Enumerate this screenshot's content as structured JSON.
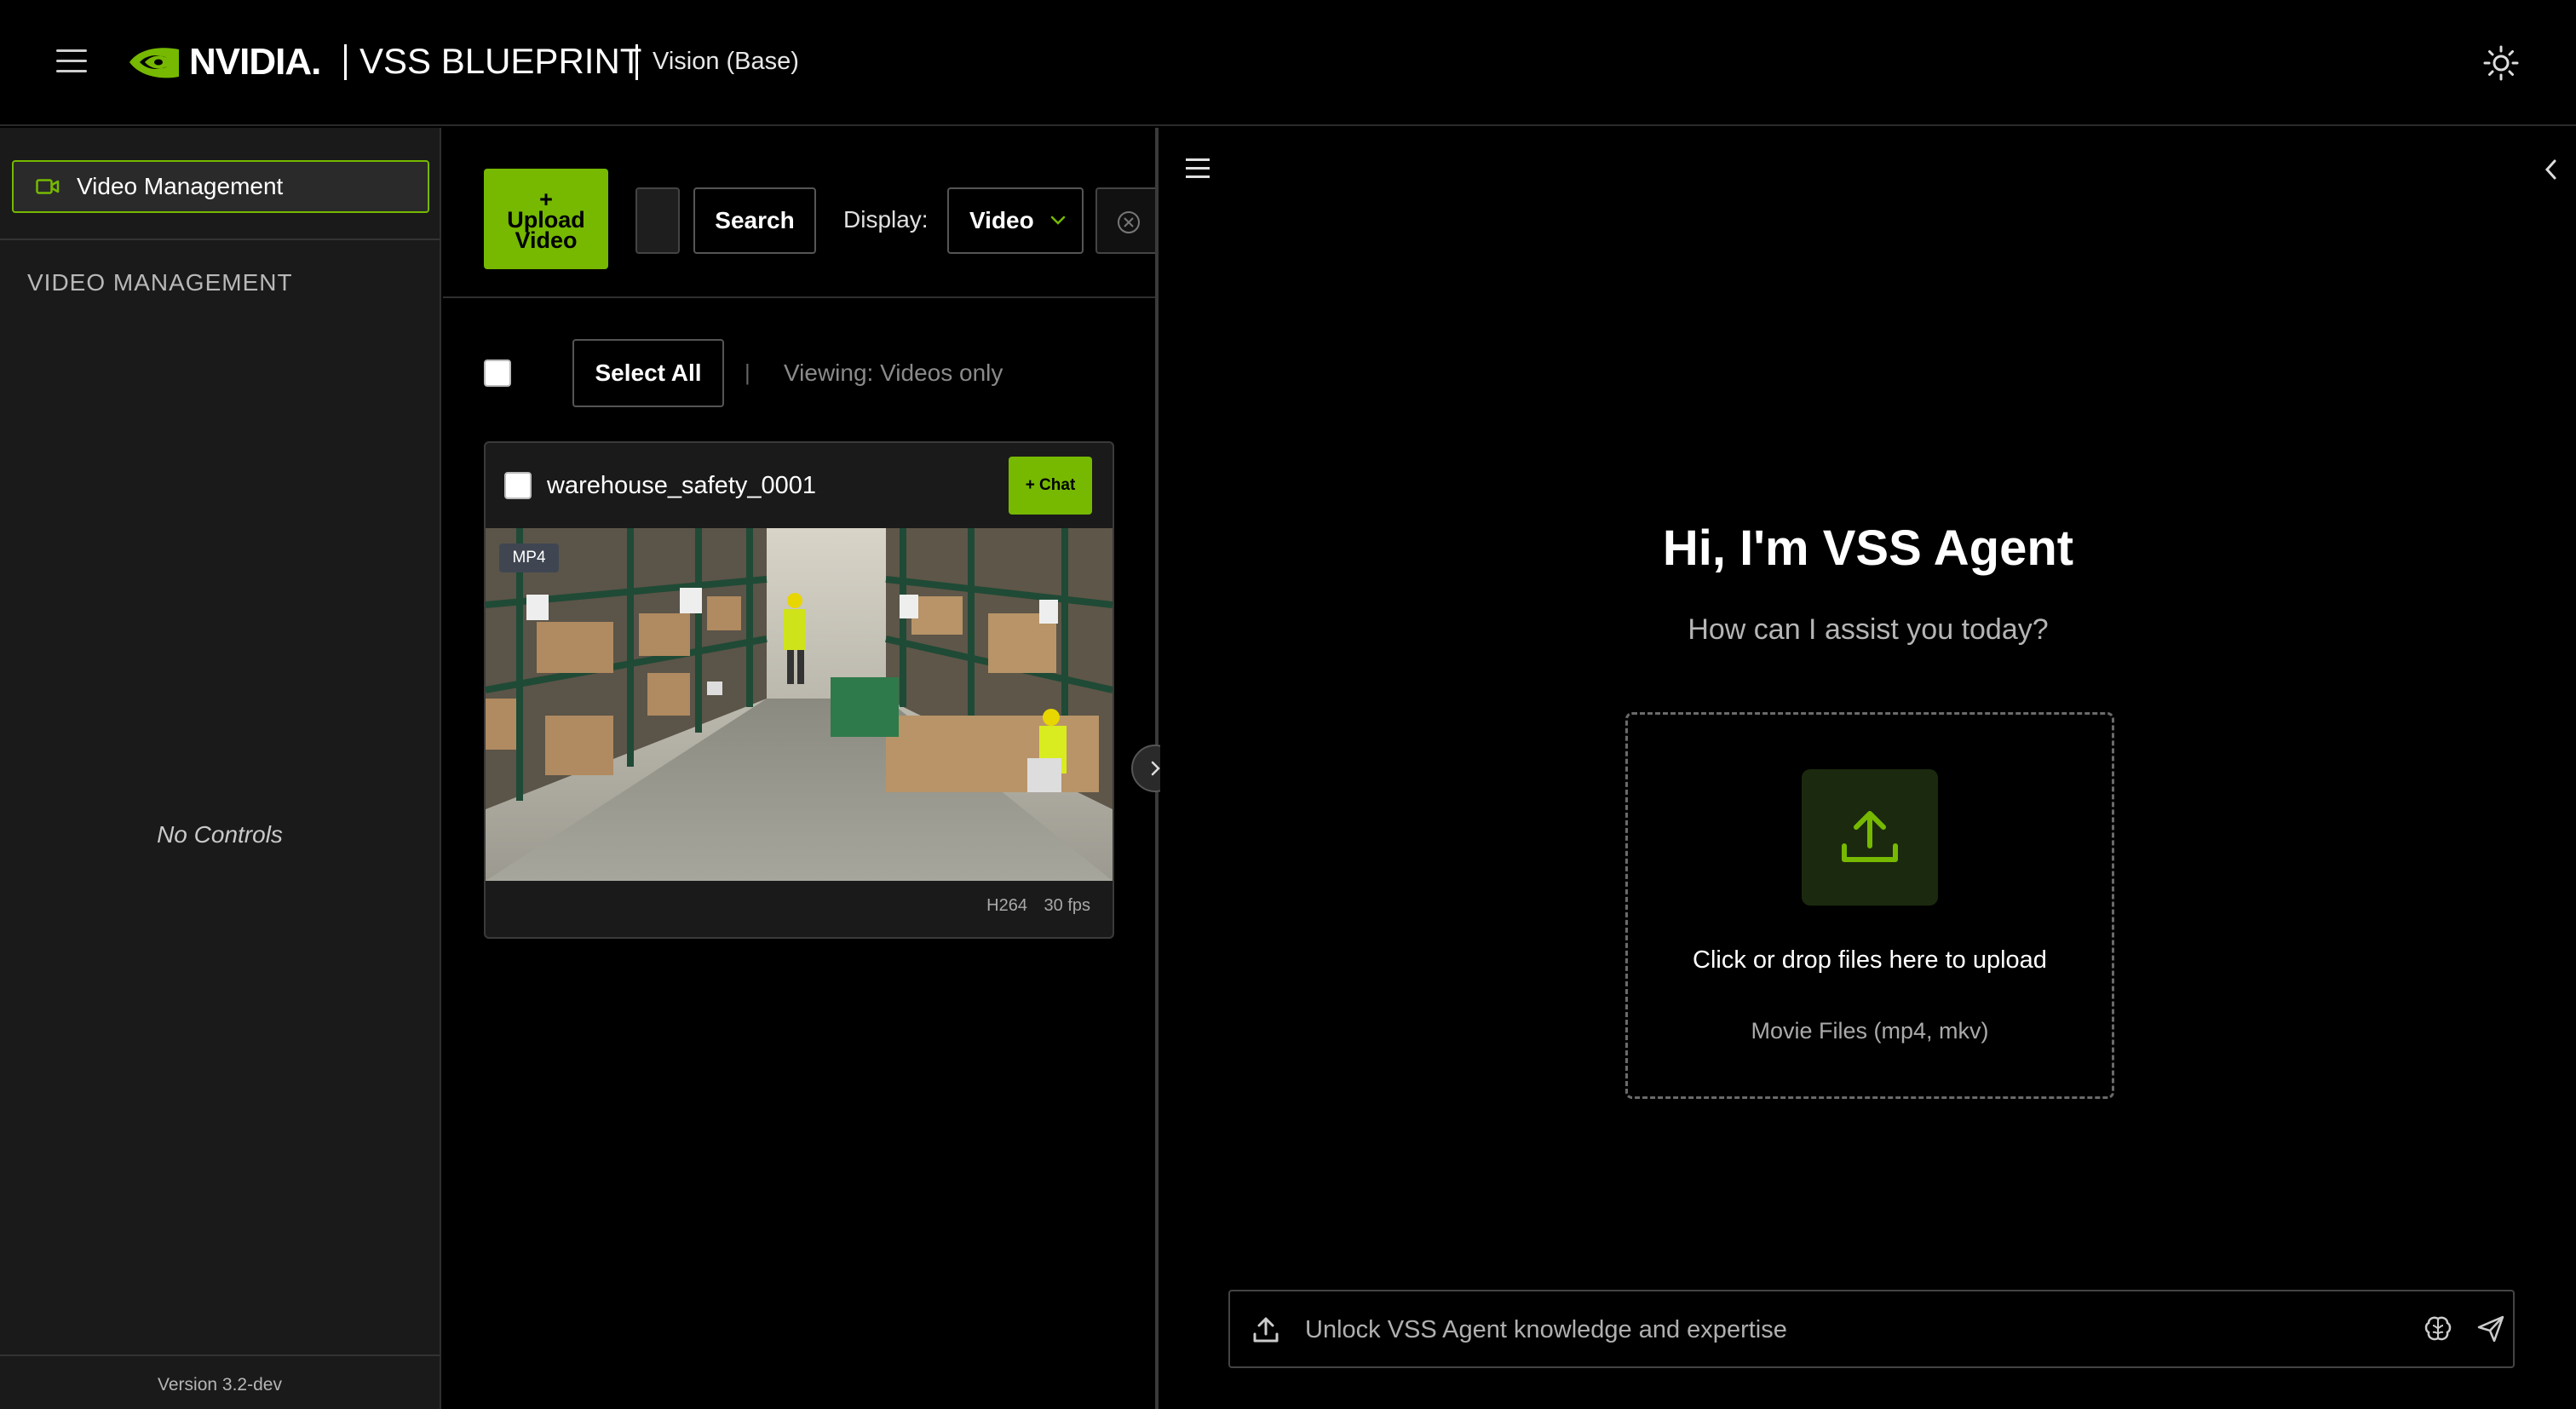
{
  "header": {
    "brand": "NVIDIA.",
    "title": "VSS BLUEPRINT",
    "subtitle": "Vision (Base)"
  },
  "sidebar": {
    "nav_item": "Video Management",
    "heading": "VIDEO MANAGEMENT",
    "empty_text": "No Controls",
    "version": "Version 3.2-dev"
  },
  "toolbar": {
    "upload_label_line1": "+",
    "upload_label_line2": "Upload",
    "upload_label_line3": "Video",
    "search_label": "Search",
    "display_label": "Display:",
    "display_value": "Video"
  },
  "list": {
    "select_all_label": "Select All",
    "separator": "|",
    "viewing_text": "Viewing: Videos only",
    "videos": [
      {
        "name": "warehouse_safety_0001",
        "chat_label": "+ Chat",
        "format_badge": "MP4",
        "codec": "H264",
        "fps": "30 fps"
      }
    ]
  },
  "agent": {
    "greeting": "Hi, I'm VSS Agent",
    "prompt": "How can I assist you today?",
    "dropzone_main": "Click or drop files here to upload",
    "dropzone_sub": "Movie Files (mp4, mkv)",
    "input_placeholder": "Unlock VSS Agent knowledge and expertise"
  },
  "colors": {
    "accent": "#76b900",
    "background": "#000000",
    "sidebar_bg": "#1a1a1a"
  },
  "icons": {
    "menu": "hamburger-icon",
    "theme": "sun-icon",
    "nav": "video-camera-icon",
    "clear": "circle-x-icon",
    "expand": "chevron-right-icon",
    "collapse": "chevron-left-icon",
    "upload": "upload-icon",
    "brain": "brain-icon",
    "send": "send-icon"
  }
}
